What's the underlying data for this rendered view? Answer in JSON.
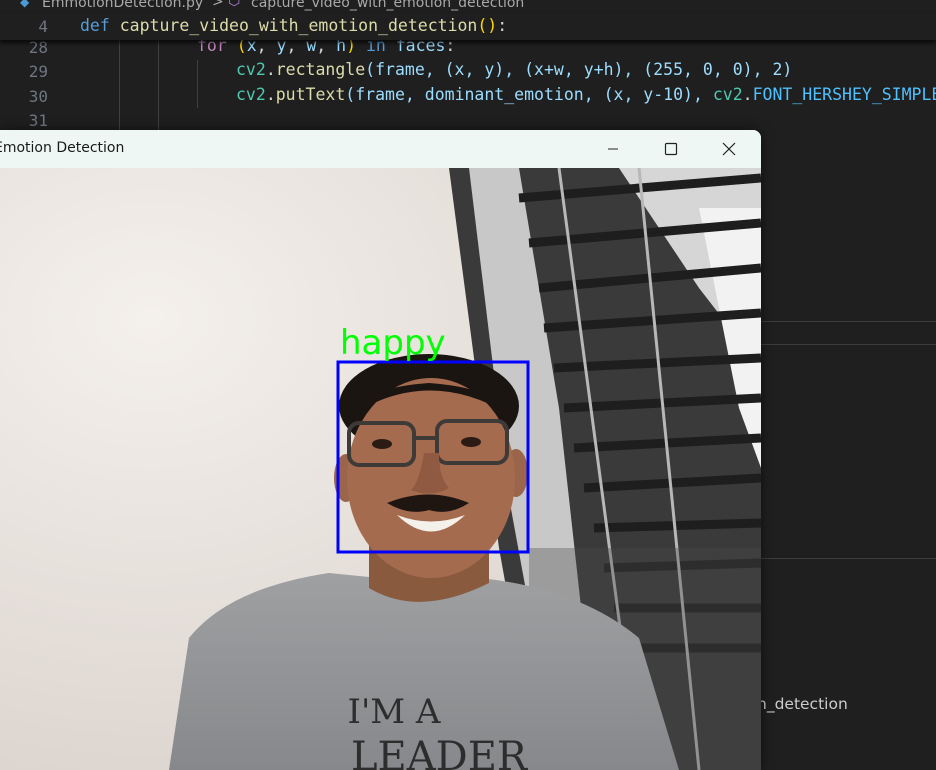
{
  "breadcrumb": {
    "file_icon": "python-file-icon",
    "file": "EmmotionDetection.py",
    "separator": ">",
    "symbol_icon": "method-cube-icon",
    "symbol": "capture_video_with_emotion_detection"
  },
  "sticky": {
    "line_number": "4",
    "keyword": "def",
    "function_name": "capture_video_with_emotion_detection",
    "parens": "()",
    "colon": ":"
  },
  "code_lines": {
    "l28": {
      "num": "28",
      "kw": "for",
      "rest_a": " (",
      "x": "x",
      "c1": ", ",
      "y": "y",
      "c2": ", ",
      "w": "w",
      "c3": ", ",
      "h": "h",
      "rest_b": ") ",
      "in_kw": "in",
      "faces": " faces",
      "colon": ":"
    },
    "l29": {
      "num": "29",
      "obj": "cv2",
      "dot": ".",
      "fn": "rectangle",
      "args": "(frame, (x, y), (x+w, y+h), (255, 0, 0), 2)"
    },
    "l30": {
      "num": "30",
      "obj": "cv2",
      "dot": ".",
      "fn": "putText",
      "args": "(frame, dominant_emotion, (x, y-10), ",
      "const_obj": "cv2",
      "const_dot": ".",
      "const": "FONT_HERSHEY_SIMPLEX",
      "tail": ","
    },
    "l31": {
      "num": "31"
    }
  },
  "right_panel": {
    "visible_text": "n_detection"
  },
  "cv_window": {
    "title": "Emotion Detection",
    "min_icon": "minimize-icon",
    "max_icon": "maximize-icon",
    "close_icon": "close-icon",
    "detected_emotion": "happy",
    "box_color": "#0000ff",
    "label_color": "#00ff00",
    "shirt_text_line1": "I'M A",
    "shirt_text_line2": "LEADER"
  }
}
